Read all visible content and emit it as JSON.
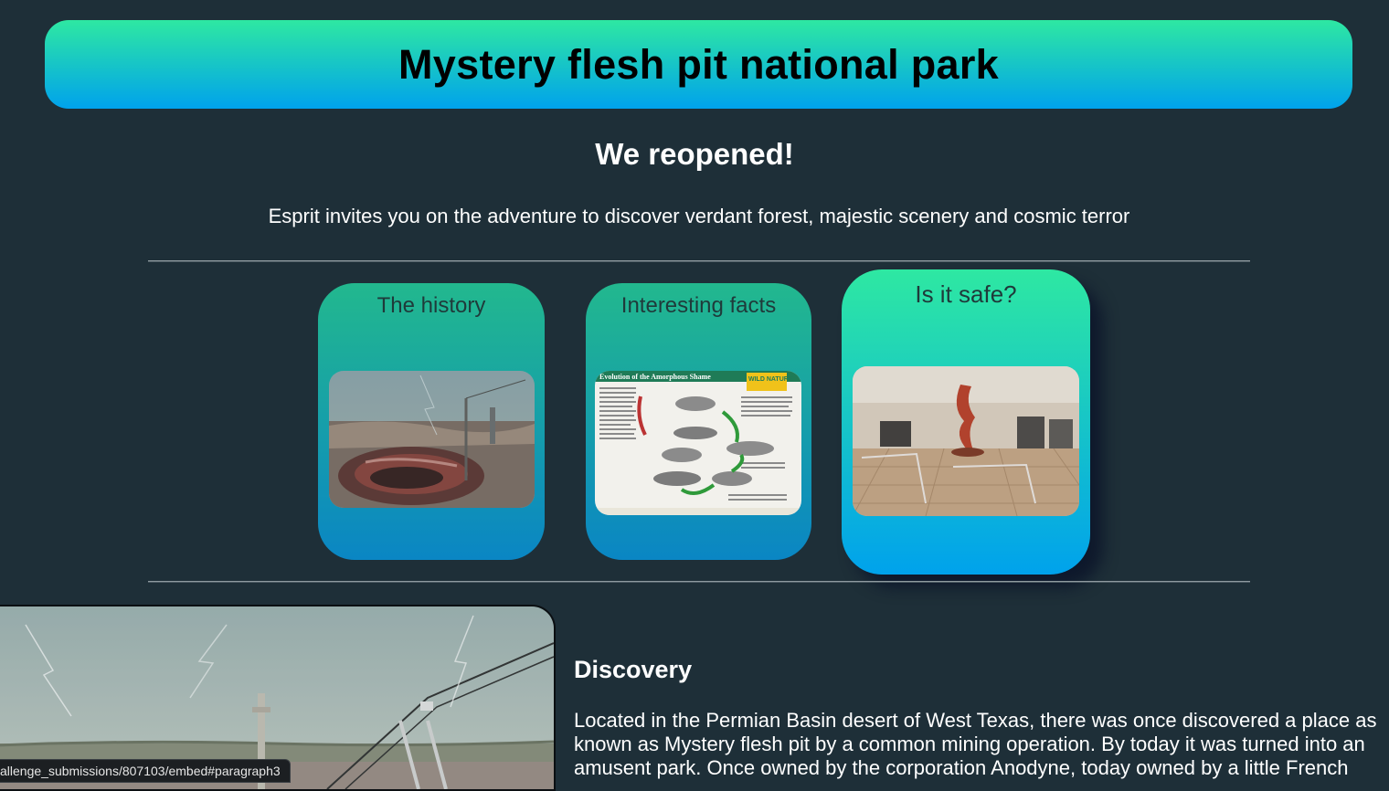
{
  "header": {
    "title": "Mystery flesh pit national park"
  },
  "intro": {
    "heading": "We reopened!",
    "tagline": "Esprit invites you on the adventure to discover verdant forest, majestic scenery and cosmic terror"
  },
  "cards": [
    {
      "label": "The history",
      "image": "flesh-pit-crater-photo"
    },
    {
      "label": "Interesting facts",
      "image": "evolution-poster-photo",
      "image_text": "Evolution of the Amorphous Shame",
      "badge": "WILD NATURE"
    },
    {
      "label": "Is it safe?",
      "image": "museum-exhibit-photo"
    }
  ],
  "discovery": {
    "heading": "Discovery",
    "text": "Located in the Permian Basin desert of West Texas, there was once discovered a place as known as Mystery flesh pit by a common mining operation. By today it was turned into an amusent park. Once owned by the corporation Anodyne, today owned by a little French"
  },
  "status_bar": {
    "url": "allenge_submissions/807103/embed#paragraph3"
  },
  "colors": {
    "background": "#1e2f38",
    "gradient_top": "#2ee8a2",
    "gradient_bottom": "#00a2ec"
  }
}
